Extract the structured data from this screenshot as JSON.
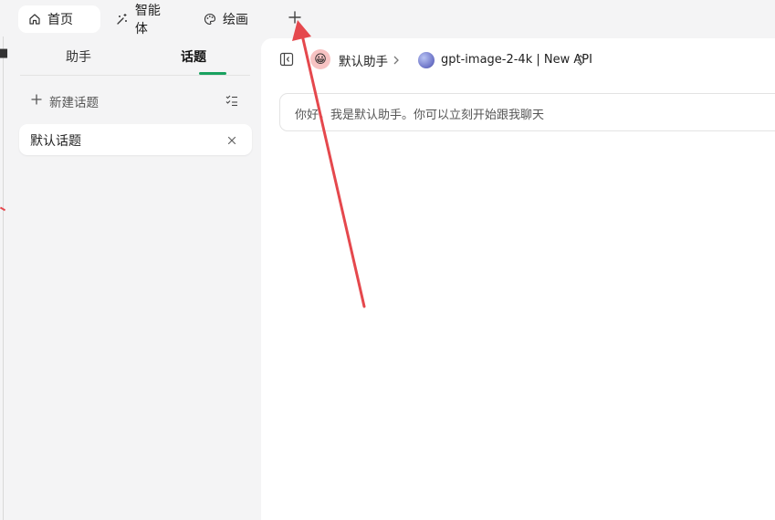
{
  "tabs": [
    {
      "label": "首页",
      "icon": "home-icon",
      "active": true
    },
    {
      "label": "智能体",
      "icon": "sparkle-wand-icon",
      "active": false
    },
    {
      "label": "绘画",
      "icon": "palette-icon",
      "active": false
    }
  ],
  "tab_add_icon": "plus-icon",
  "sidebar": {
    "tabs": [
      "助手",
      "话题"
    ],
    "active_tab": "话题",
    "accent": "#19a15f",
    "new_topic_label": "新建话题",
    "topics": [
      {
        "label": "默认话题"
      }
    ]
  },
  "header": {
    "assistant_name": "默认助手",
    "model_name": "gpt-image-2-4k | New API"
  },
  "chat": {
    "welcome_message": "你好，我是默认助手。你可以立刻开始跟我聊天"
  },
  "annotation": {
    "color": "#e5484d"
  }
}
